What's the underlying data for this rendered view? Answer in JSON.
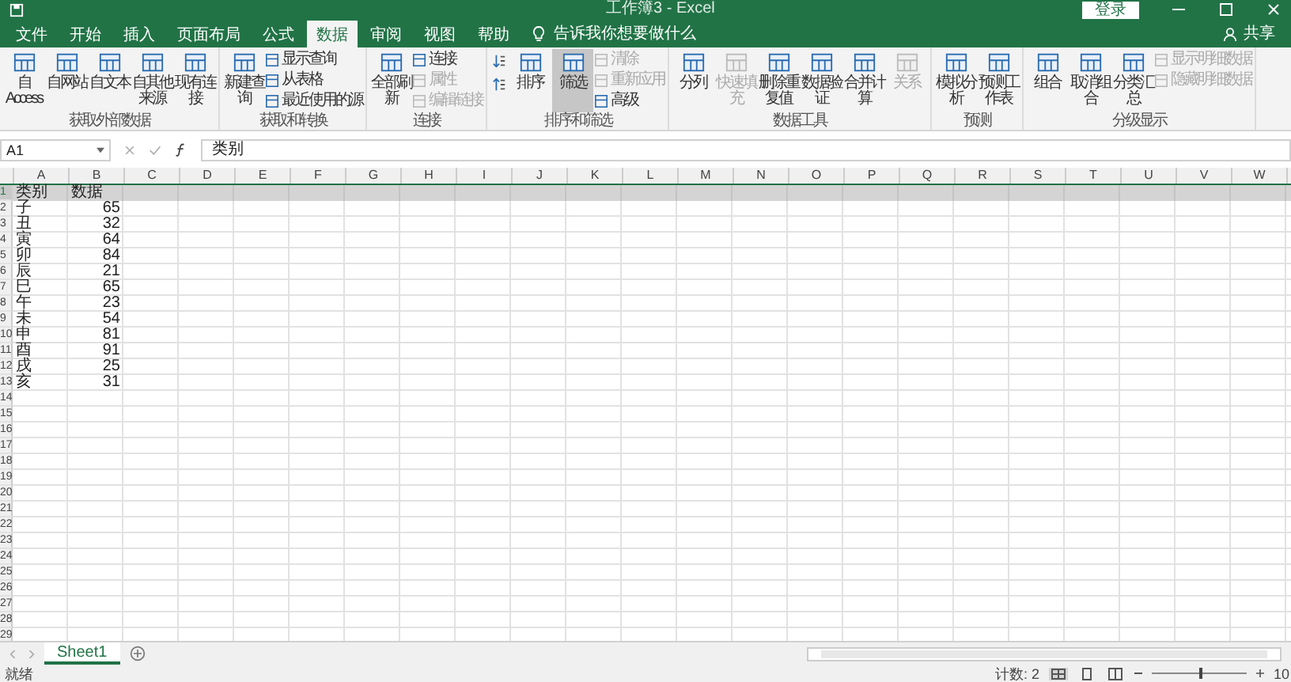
{
  "title_bar": {
    "title": "工作簿3 - Excel",
    "sign_in": "登录"
  },
  "tabs": [
    {
      "label": "文件",
      "selected": false
    },
    {
      "label": "开始",
      "selected": false
    },
    {
      "label": "插入",
      "selected": false
    },
    {
      "label": "页面布局",
      "selected": false
    },
    {
      "label": "公式",
      "selected": false
    },
    {
      "label": "数据",
      "selected": true
    },
    {
      "label": "审阅",
      "selected": false
    },
    {
      "label": "视图",
      "selected": false
    },
    {
      "label": "帮助",
      "selected": false
    }
  ],
  "tell_me": "告诉我你想要做什么",
  "share": "共享",
  "ribbon_groups": [
    {
      "label": "获取外部数据",
      "items": [
        {
          "kind": "large",
          "label": "自 Access",
          "disabled": false,
          "pressed": false
        },
        {
          "kind": "large",
          "label": "自网站",
          "disabled": false,
          "pressed": false
        },
        {
          "kind": "large",
          "label": "自文本",
          "disabled": false,
          "pressed": false
        },
        {
          "kind": "large",
          "label": "自其他来源",
          "disabled": false,
          "pressed": false
        },
        {
          "kind": "large",
          "label": "现有连接",
          "disabled": false,
          "pressed": false
        }
      ]
    },
    {
      "label": "获取和转换",
      "items": [
        {
          "kind": "large",
          "label": "新建查询",
          "disabled": false,
          "pressed": false
        },
        {
          "kind": "small",
          "label": "显示查询",
          "disabled": false
        },
        {
          "kind": "small",
          "label": "从表格",
          "disabled": false
        },
        {
          "kind": "small",
          "label": "最近使用的源",
          "disabled": false
        }
      ]
    },
    {
      "label": "连接",
      "items": [
        {
          "kind": "large",
          "label": "全部刷新",
          "disabled": false,
          "pressed": false
        },
        {
          "kind": "small",
          "label": "连接",
          "disabled": false
        },
        {
          "kind": "small",
          "label": "属性",
          "disabled": true
        },
        {
          "kind": "small",
          "label": "编辑链接",
          "disabled": true
        }
      ]
    },
    {
      "label": "排序和筛选",
      "items": [
        {
          "kind": "sort"
        },
        {
          "kind": "large",
          "label": "排序",
          "disabled": false,
          "pressed": false
        },
        {
          "kind": "large",
          "label": "筛选",
          "disabled": false,
          "pressed": true
        },
        {
          "kind": "small",
          "label": "清除",
          "disabled": true
        },
        {
          "kind": "small",
          "label": "重新应用",
          "disabled": true
        },
        {
          "kind": "small",
          "label": "高级",
          "disabled": false
        }
      ]
    },
    {
      "label": "数据工具",
      "items": [
        {
          "kind": "large",
          "label": "分列",
          "disabled": false,
          "pressed": false
        },
        {
          "kind": "large",
          "label": "快速填充",
          "disabled": true,
          "pressed": false
        },
        {
          "kind": "large",
          "label": "删除重复值",
          "disabled": false,
          "pressed": false
        },
        {
          "kind": "large",
          "label": "数据验证",
          "disabled": false,
          "pressed": false
        },
        {
          "kind": "large",
          "label": "合并计算",
          "disabled": false,
          "pressed": false
        },
        {
          "kind": "large",
          "label": "关系",
          "disabled": true,
          "pressed": false
        }
      ]
    },
    {
      "label": "预测",
      "items": [
        {
          "kind": "large",
          "label": "模拟分析",
          "disabled": false,
          "pressed": false
        },
        {
          "kind": "large",
          "label": "预测工作表",
          "disabled": false,
          "pressed": false
        }
      ]
    },
    {
      "label": "分级显示",
      "items": [
        {
          "kind": "large",
          "label": "组合",
          "disabled": false,
          "pressed": false
        },
        {
          "kind": "large",
          "label": "取消组合",
          "disabled": false,
          "pressed": false
        },
        {
          "kind": "large",
          "label": "分类汇总",
          "disabled": false,
          "pressed": false
        },
        {
          "kind": "small",
          "label": "显示明细数据",
          "disabled": true
        },
        {
          "kind": "small",
          "label": "隐藏明细数据",
          "disabled": true
        }
      ]
    }
  ],
  "formula_bar": {
    "name_box": "A1",
    "value": "类别"
  },
  "columns": [
    "A",
    "B",
    "C",
    "D",
    "E",
    "F",
    "G",
    "H",
    "I",
    "J",
    "K",
    "L",
    "M",
    "N",
    "O",
    "P",
    "Q",
    "R",
    "S",
    "T",
    "U",
    "V",
    "W"
  ],
  "rows": [
    {
      "number": "1",
      "selected": true,
      "cells": [
        {
          "text": "类别",
          "kind": "text"
        },
        {
          "text": "数据",
          "kind": "text"
        }
      ]
    },
    {
      "number": "2",
      "selected": false,
      "cells": [
        {
          "text": "子",
          "kind": "text"
        },
        {
          "text": "65",
          "kind": "number"
        }
      ]
    },
    {
      "number": "3",
      "selected": false,
      "cells": [
        {
          "text": "丑",
          "kind": "text"
        },
        {
          "text": "32",
          "kind": "number"
        }
      ]
    },
    {
      "number": "4",
      "selected": false,
      "cells": [
        {
          "text": "寅",
          "kind": "text"
        },
        {
          "text": "64",
          "kind": "number"
        }
      ]
    },
    {
      "number": "5",
      "selected": false,
      "cells": [
        {
          "text": "卯",
          "kind": "text"
        },
        {
          "text": "84",
          "kind": "number"
        }
      ]
    },
    {
      "number": "6",
      "selected": false,
      "cells": [
        {
          "text": "辰",
          "kind": "text"
        },
        {
          "text": "21",
          "kind": "number"
        }
      ]
    },
    {
      "number": "7",
      "selected": false,
      "cells": [
        {
          "text": "巳",
          "kind": "text"
        },
        {
          "text": "65",
          "kind": "number"
        }
      ]
    },
    {
      "number": "8",
      "selected": false,
      "cells": [
        {
          "text": "午",
          "kind": "text"
        },
        {
          "text": "23",
          "kind": "number"
        }
      ]
    },
    {
      "number": "9",
      "selected": false,
      "cells": [
        {
          "text": "未",
          "kind": "text"
        },
        {
          "text": "54",
          "kind": "number"
        }
      ]
    },
    {
      "number": "10",
      "selected": false,
      "cells": [
        {
          "text": "申",
          "kind": "text"
        },
        {
          "text": "81",
          "kind": "number"
        }
      ]
    },
    {
      "number": "11",
      "selected": false,
      "cells": [
        {
          "text": "酉",
          "kind": "text"
        },
        {
          "text": "91",
          "kind": "number"
        }
      ]
    },
    {
      "number": "12",
      "selected": false,
      "cells": [
        {
          "text": "戌",
          "kind": "text"
        },
        {
          "text": "25",
          "kind": "number"
        }
      ]
    },
    {
      "number": "13",
      "selected": false,
      "cells": [
        {
          "text": "亥",
          "kind": "text"
        },
        {
          "text": "31",
          "kind": "number"
        }
      ]
    },
    {
      "number": "14",
      "selected": false,
      "cells": []
    },
    {
      "number": "15",
      "selected": false,
      "cells": []
    },
    {
      "number": "16",
      "selected": false,
      "cells": []
    },
    {
      "number": "17",
      "selected": false,
      "cells": []
    },
    {
      "number": "18",
      "selected": false,
      "cells": []
    },
    {
      "number": "19",
      "selected": false,
      "cells": []
    },
    {
      "number": "20",
      "selected": false,
      "cells": []
    },
    {
      "number": "21",
      "selected": false,
      "cells": []
    },
    {
      "number": "22",
      "selected": false,
      "cells": []
    },
    {
      "number": "23",
      "selected": false,
      "cells": []
    },
    {
      "number": "24",
      "selected": false,
      "cells": []
    },
    {
      "number": "25",
      "selected": false,
      "cells": []
    },
    {
      "number": "26",
      "selected": false,
      "cells": []
    },
    {
      "number": "27",
      "selected": false,
      "cells": []
    },
    {
      "number": "28",
      "selected": false,
      "cells": []
    },
    {
      "number": "29",
      "selected": false,
      "cells": []
    }
  ],
  "sheets": [
    {
      "name": "Sheet1",
      "selected": true
    }
  ],
  "status_bar": {
    "state": "就绪",
    "count": "计数: 2",
    "zoom": {
      "level": 0.5,
      "value": "10"
    }
  }
}
